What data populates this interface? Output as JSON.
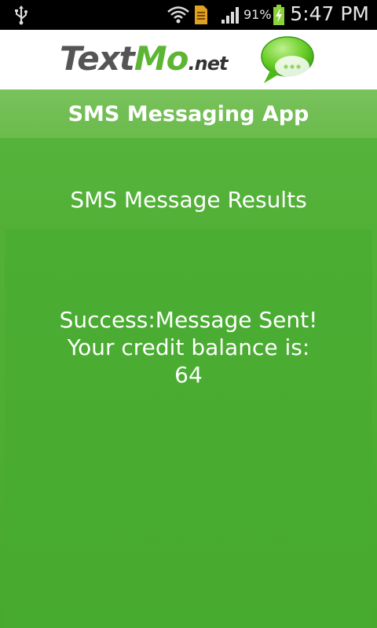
{
  "status_bar": {
    "battery_percent": "91%",
    "time": "5:47 PM"
  },
  "logo": {
    "text_part1": "Text",
    "text_part2": "Mo",
    "text_part3": ".net"
  },
  "app": {
    "title": "SMS Messaging App"
  },
  "results": {
    "heading": "SMS Message Results",
    "line1": "Success:Message Sent!",
    "line2": "Your credit balance is:",
    "credit_balance": "64"
  },
  "colors": {
    "brand_green": "#5cb533",
    "title_bar": "#74bf55",
    "background": "#4cae34"
  }
}
